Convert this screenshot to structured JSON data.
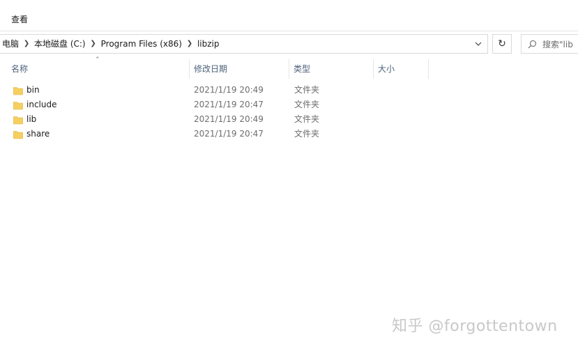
{
  "ribbon": {
    "view_tab": "查看"
  },
  "address_bar": {
    "crumbs": [
      "电脑",
      "本地磁盘 (C:)",
      "Program Files (x86)",
      "libzip"
    ],
    "refresh_icon": "refresh-icon",
    "dropdown_icon": "chevron-down-icon"
  },
  "search": {
    "placeholder": "搜索\"lib"
  },
  "columns": {
    "name": "名称",
    "date": "修改日期",
    "type": "类型",
    "size": "大小"
  },
  "files": [
    {
      "name": "bin",
      "date": "2021/1/19 20:49",
      "type": "文件夹"
    },
    {
      "name": "include",
      "date": "2021/1/19 20:47",
      "type": "文件夹"
    },
    {
      "name": "lib",
      "date": "2021/1/19 20:49",
      "type": "文件夹"
    },
    {
      "name": "share",
      "date": "2021/1/19 20:47",
      "type": "文件夹"
    }
  ],
  "watermark": "知乎 @forgottentown",
  "colors": {
    "folder": "#f5cf5f",
    "header_text": "#4c607a"
  }
}
